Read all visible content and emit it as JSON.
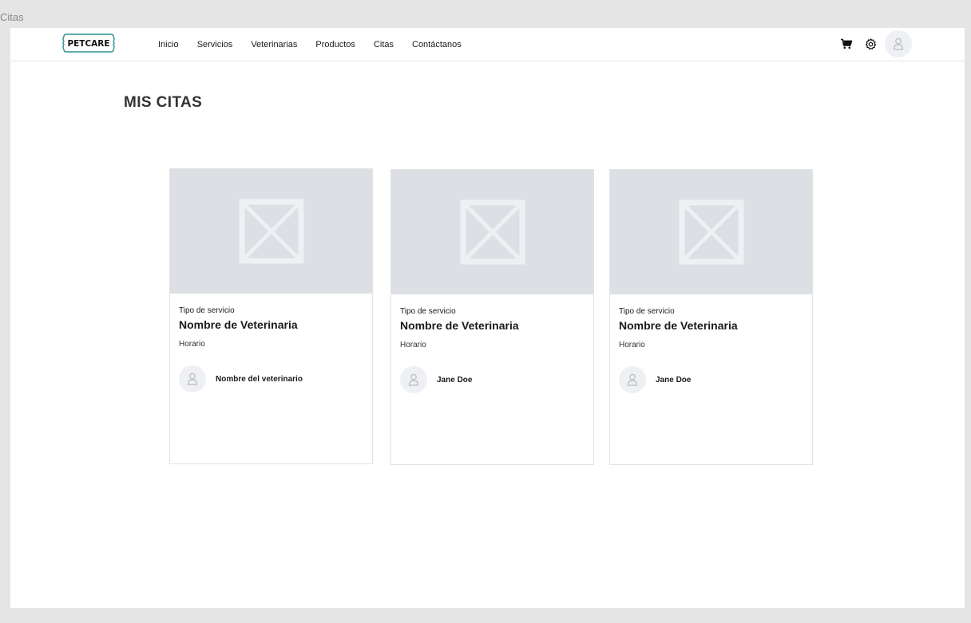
{
  "frame": {
    "label": "Citas"
  },
  "navbar": {
    "logo_text": "PETCARE",
    "links": [
      "Inicio",
      "Servicios",
      "Veterinarias",
      "Productos",
      "Citas",
      "Contáctanos"
    ],
    "icons": {
      "cart": "cart-icon",
      "settings": "gear-icon",
      "avatar": "user-icon"
    }
  },
  "page": {
    "title": "MIS CITAS"
  },
  "cards": [
    {
      "service": "Tipo de servicio",
      "clinic": "Nombre de Veterinaria",
      "schedule": "Horario",
      "vet": "Nombre del veterinario"
    },
    {
      "service": "Tipo de servicio",
      "clinic": "Nombre de Veterinaria",
      "schedule": "Horario",
      "vet": "Jane Doe"
    },
    {
      "service": "Tipo de servicio",
      "clinic": "Nombre de Veterinaria",
      "schedule": "Horario",
      "vet": "Jane Doe"
    }
  ],
  "colors": {
    "logo_accent": "#2f8f8f",
    "image_placeholder": "#dcdfe4",
    "avatar_bg": "#eef0f3"
  }
}
